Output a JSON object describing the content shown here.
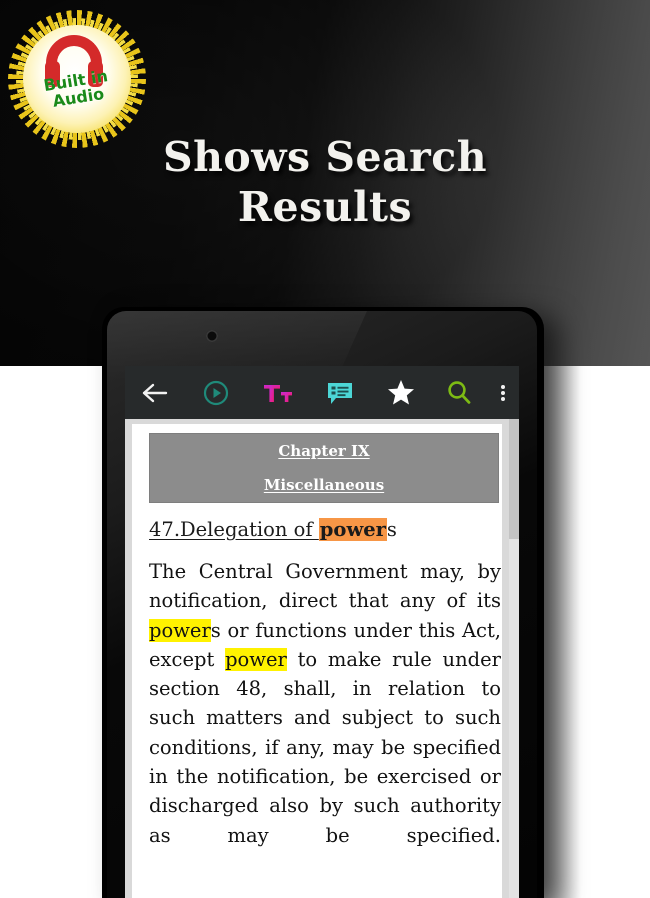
{
  "promo": {
    "headline_line1": "Shows Search",
    "headline_line2": "Results",
    "badge": {
      "icon": "headphones-icon",
      "line1": "Built in",
      "line2": "Audio",
      "text_color": "#1a8a1a",
      "icon_color": "#d42a2a",
      "burst_color": "#e8c41a"
    },
    "background_colors": {
      "dark": "#0a0a0a",
      "light": "#bdbdbd",
      "page": "#ffffff"
    }
  },
  "app": {
    "toolbar": {
      "background": "#272a2b",
      "items": [
        {
          "name": "back-button",
          "icon": "arrow-left-icon",
          "color": "#f2f2f2"
        },
        {
          "name": "play-button",
          "icon": "play-circle-icon",
          "color": "#1f8a7a"
        },
        {
          "name": "font-size-button",
          "icon": "text-size-icon",
          "color": "#e0219c"
        },
        {
          "name": "notes-button",
          "icon": "chat-list-icon",
          "color": "#4cd6d6"
        },
        {
          "name": "bookmark-button",
          "icon": "star-icon",
          "color": "#ffffff"
        },
        {
          "name": "search-button",
          "icon": "magnifier-icon",
          "color": "#7dbb14"
        },
        {
          "name": "overflow-menu-button",
          "icon": "three-dots-vertical-icon",
          "color": "#f2f2f2"
        }
      ]
    },
    "document": {
      "banner": {
        "background": "#8c8c8c",
        "line1": "Chapter IX",
        "line2": "Miscellaneous"
      },
      "section_heading": {
        "prefix": "47.Delegation of ",
        "highlight": "power",
        "suffix": "s",
        "highlight_color": "#f79646"
      },
      "body": {
        "highlight_color": "#fff200",
        "segments": [
          {
            "text": "The Central Government may, by notification, direct that any of its ",
            "highlight": false
          },
          {
            "text": "power",
            "highlight": true
          },
          {
            "text": "s or functions under this Act, except ",
            "highlight": false
          },
          {
            "text": "power",
            "highlight": true
          },
          {
            "text": " to make rule under section 48, shall, in relation to such matters and subject to such conditions, if any, may be specified in the notification, be exercised or discharged also by such authority as may be specified.",
            "highlight": false
          }
        ]
      }
    }
  }
}
